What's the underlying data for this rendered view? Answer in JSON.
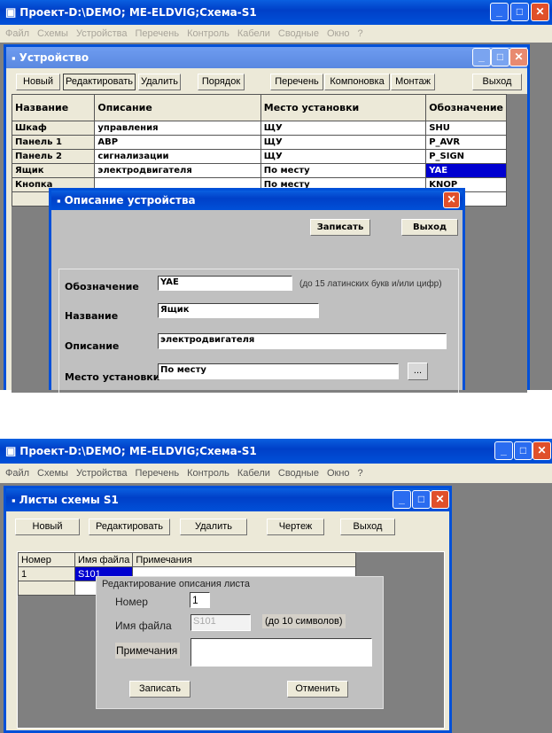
{
  "top": {
    "app_title": "Проект-D:\\DEMO; ME-ELDVIG;Схема-S1",
    "menu": [
      "Файл",
      "Схемы",
      "Устройства",
      "Перечень",
      "Контроль",
      "Кабели",
      "Сводные",
      "Окно",
      "?"
    ],
    "child_title": "Устройство",
    "buttons": {
      "new": "Новый",
      "edit": "Редактировать",
      "delete": "Удалить",
      "order": "Порядок",
      "list": "Перечень",
      "layout": "Компоновка",
      "mount": "Монтаж",
      "exit": "Выход"
    },
    "columns": [
      "Название",
      "Описание",
      "Место установки",
      "Обозначение"
    ],
    "rows": [
      [
        "Шкаф",
        "управления",
        "ЩУ",
        "SHU"
      ],
      [
        "Панель 1",
        "АВР",
        "ЩУ",
        "P_AVR"
      ],
      [
        "Панель 2",
        "сигнализации",
        "ЩУ",
        "P_SIGN"
      ],
      [
        "Ящик",
        "электродвигателя",
        "По месту",
        "YAE"
      ],
      [
        "Кнопка",
        "",
        "По месту",
        "KNOP"
      ]
    ],
    "dialog": {
      "title": "Описание устройства",
      "save": "Записать",
      "exit": "Выход",
      "designation_label": "Обозначение",
      "designation_value": "YAE",
      "designation_hint": "(до 15 латинских букв и/или цифр)",
      "name_label": "Название",
      "name_value": "Ящик",
      "description_label": "Описание",
      "description_value": "электродвигателя",
      "location_label": "Место установки",
      "location_value": "По месту",
      "browse": "..."
    }
  },
  "bottom": {
    "app_title": "Проект-D:\\DEMO; ME-ELDVIG;Схема-S1",
    "menu": [
      "Файл",
      "Схемы",
      "Устройства",
      "Перечень",
      "Контроль",
      "Кабели",
      "Сводные",
      "Окно",
      "?"
    ],
    "child_title": "Листы схемы S1",
    "buttons": {
      "new": "Новый",
      "edit": "Редактировать",
      "delete": "Удалить",
      "drawing": "Чертеж",
      "exit": "Выход"
    },
    "columns": [
      "Номер",
      "Имя файла",
      "Примечания"
    ],
    "rows": [
      [
        "1",
        "S101",
        ""
      ]
    ],
    "panel": {
      "legend": "Редактирование описания листа",
      "number_label": "Номер",
      "number_value": "1",
      "file_label": "Имя файла",
      "file_value": "S101",
      "file_hint": "(до 10 символов)",
      "notes_label": "Примечания",
      "notes_value": "",
      "save": "Записать",
      "cancel": "Отменить"
    }
  }
}
